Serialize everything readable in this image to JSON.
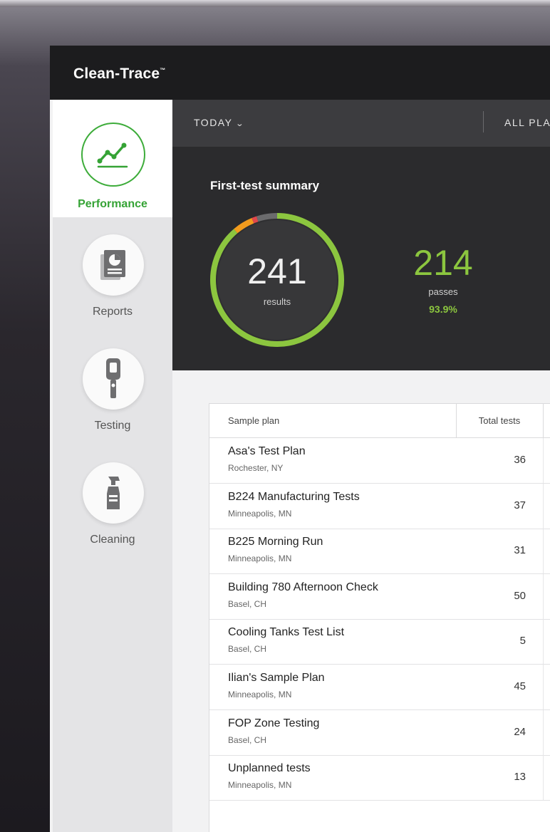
{
  "app": {
    "title": "Clean-Trace",
    "trademark": "™"
  },
  "sidebar": {
    "items": [
      {
        "label": "Performance",
        "icon": "performance-chart-icon",
        "active": true
      },
      {
        "label": "Reports",
        "icon": "reports-icon",
        "active": false
      },
      {
        "label": "Testing",
        "icon": "testing-device-icon",
        "active": false
      },
      {
        "label": "Cleaning",
        "icon": "spray-bottle-icon",
        "active": false
      }
    ]
  },
  "filters": {
    "period": "TODAY",
    "plans": "ALL PLANS"
  },
  "summary": {
    "title": "First-test summary",
    "total_results": "241",
    "results_label": "results",
    "passes": "214",
    "passes_label": "passes",
    "pass_rate": "93.9%",
    "ring_segments": [
      {
        "name": "pass",
        "fraction": 0.888,
        "color": "#8cc63f"
      },
      {
        "name": "caution",
        "fraction": 0.05,
        "color": "#f29b1d"
      },
      {
        "name": "fail",
        "fraction": 0.012,
        "color": "#e2474b"
      },
      {
        "name": "other",
        "fraction": 0.05,
        "color": "#6b6b6d"
      }
    ]
  },
  "table": {
    "headers": {
      "plan": "Sample plan",
      "total": "Total tests"
    },
    "rows": [
      {
        "name": "Asa's Test Plan",
        "location": "Rochester, NY",
        "total": "36"
      },
      {
        "name": "B224 Manufacturing Tests",
        "location": "Minneapolis, MN",
        "total": "37"
      },
      {
        "name": "B225 Morning Run",
        "location": "Minneapolis, MN",
        "total": "31"
      },
      {
        "name": "Building 780 Afternoon Check",
        "location": "Basel, CH",
        "total": "50"
      },
      {
        "name": "Cooling Tanks Test List",
        "location": "Basel, CH",
        "total": "5"
      },
      {
        "name": "Ilian's Sample Plan",
        "location": "Minneapolis, MN",
        "total": "45"
      },
      {
        "name": "FOP Zone Testing",
        "location": "Basel, CH",
        "total": "24"
      },
      {
        "name": "Unplanned tests",
        "location": "Minneapolis, MN",
        "total": "13"
      }
    ]
  }
}
